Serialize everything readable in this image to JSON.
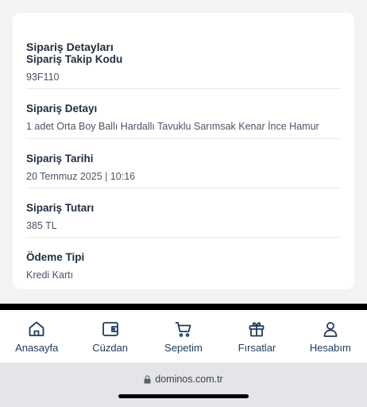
{
  "order": {
    "title": "Sipariş Detayları",
    "rows": [
      {
        "label": "Sipariş Takip Kodu",
        "value": "93F110"
      },
      {
        "label": "Sipariş Detayı",
        "value": "1 adet Orta Boy Ballı Hardallı Tavuklu Sarımsak Kenar İnce Hamur"
      },
      {
        "label": "Sipariş Tarihi",
        "value": "20 Temmuz 2025 | 10:16"
      },
      {
        "label": "Sipariş Tutarı",
        "value": "385 TL"
      },
      {
        "label": "Ödeme Tipi",
        "value": "Kredi Kartı"
      }
    ]
  },
  "tabs": [
    {
      "label": "Anasayfa",
      "icon": "home-icon"
    },
    {
      "label": "Cüzdan",
      "icon": "wallet-icon"
    },
    {
      "label": "Sepetim",
      "icon": "cart-icon"
    },
    {
      "label": "Fırsatlar",
      "icon": "gift-icon"
    },
    {
      "label": "Hesabım",
      "icon": "user-icon"
    }
  ],
  "browser": {
    "url": "dominos.com.tr"
  },
  "colors": {
    "tab_icon": "#1f3a5c",
    "text": "#1f2d3d",
    "background": "#f2f3f5"
  }
}
